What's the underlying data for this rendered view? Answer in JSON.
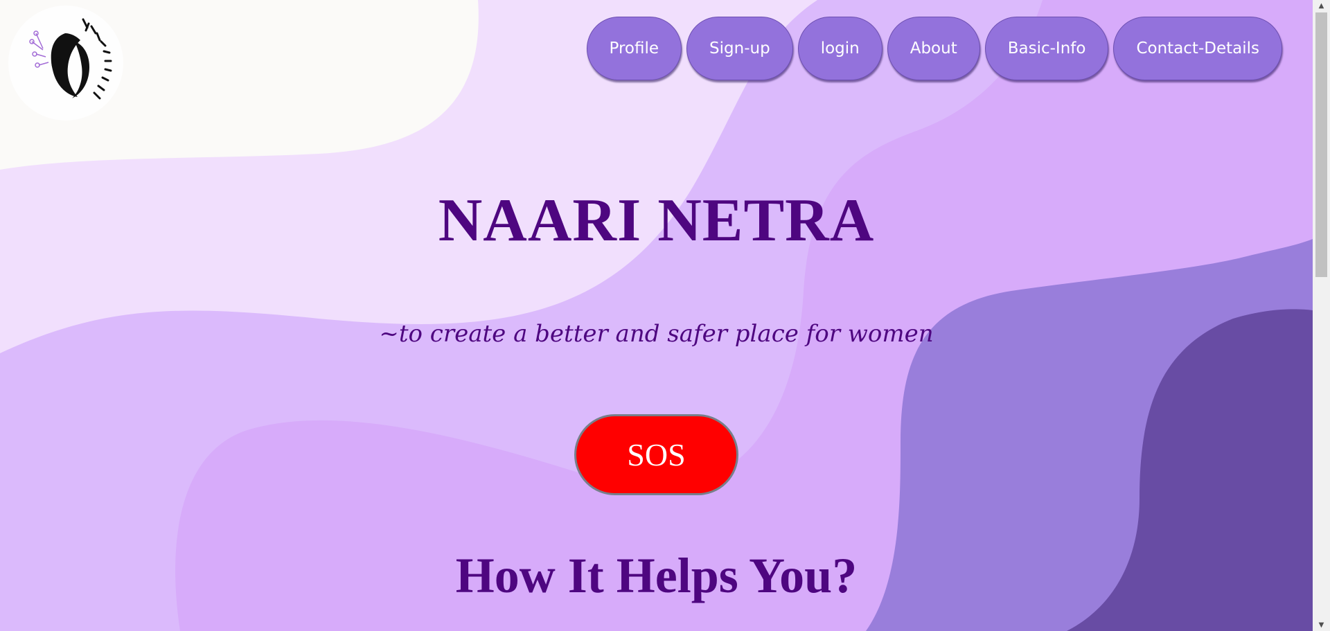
{
  "brand": {
    "logo_text": "NAARI NETRA"
  },
  "nav": {
    "items": [
      {
        "label": "Profile"
      },
      {
        "label": "Sign-up"
      },
      {
        "label": "login"
      },
      {
        "label": "About"
      },
      {
        "label": "Basic-Info"
      },
      {
        "label": "Contact-Details"
      }
    ]
  },
  "hero": {
    "title": "NAARI NETRA",
    "tagline": "~to create a better and safer place for women",
    "sos_label": "SOS",
    "section_heading": "How It Helps You?"
  },
  "colors": {
    "nav_button": "#9372dc",
    "heading_text": "#4e0680",
    "sos_button": "#ff0000",
    "wave_light": "#f2dfff",
    "wave_mid": "#d9b1fb",
    "wave_deep": "#9a7edb",
    "wave_darkest": "#684ca4"
  },
  "icons": {
    "scroll_up": "arrow-up-icon",
    "scroll_down": "arrow-down-icon"
  }
}
